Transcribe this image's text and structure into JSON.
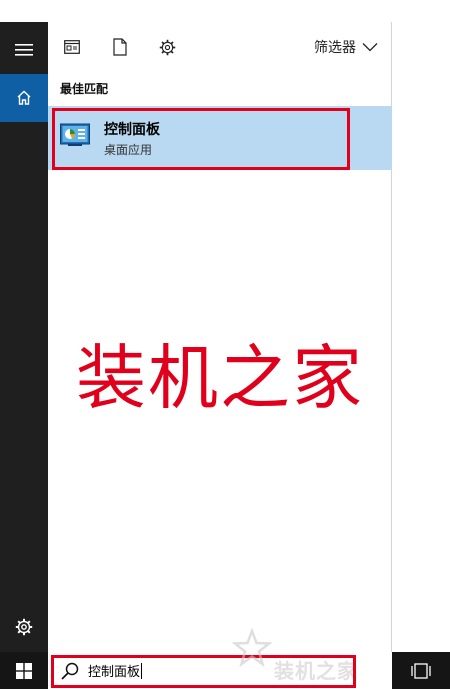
{
  "toolbar": {
    "icons": [
      "document-list-icon",
      "page-icon",
      "gear-icon"
    ],
    "filter_label": "筛选器"
  },
  "results": {
    "section_title": "最佳匹配",
    "best_match": {
      "name": "控制面板",
      "type": "桌面应用"
    }
  },
  "watermark": {
    "big_text": "装机之家",
    "small_text": "装机之家"
  },
  "search": {
    "query": "控制面板"
  },
  "colors": {
    "rail": "#1f1f1f",
    "home_active": "#0e5fa3",
    "result_selected": "#b9d9f2",
    "annotation_red": "#e0001b",
    "taskbar": "#151515"
  }
}
